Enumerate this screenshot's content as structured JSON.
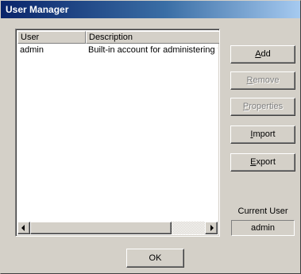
{
  "window": {
    "title": "User Manager"
  },
  "users_list": {
    "columns": [
      "User",
      "Description"
    ],
    "rows": [
      {
        "user": "admin",
        "description": "Built-in account for administering the"
      }
    ]
  },
  "buttons": {
    "add": {
      "pre": "",
      "accel": "A",
      "rest": "dd",
      "enabled": true
    },
    "remove": {
      "pre": "",
      "accel": "R",
      "rest": "emove",
      "enabled": false
    },
    "properties": {
      "pre": "",
      "accel": "P",
      "rest": "roperties",
      "enabled": false
    },
    "import": {
      "pre": "",
      "accel": "I",
      "rest": "mport",
      "enabled": true
    },
    "export": {
      "pre": "",
      "accel": "E",
      "rest": "xport",
      "enabled": true
    },
    "ok": {
      "label": "OK",
      "enabled": true
    }
  },
  "current_user": {
    "label": "Current User",
    "value": "admin"
  },
  "colors": {
    "face": "#d4d0c8",
    "title_start": "#0a246a",
    "title_end": "#a6caf0",
    "disabled_text": "#808080"
  },
  "icons": [
    "scroll-left-arrow-icon",
    "scroll-right-arrow-icon"
  ]
}
